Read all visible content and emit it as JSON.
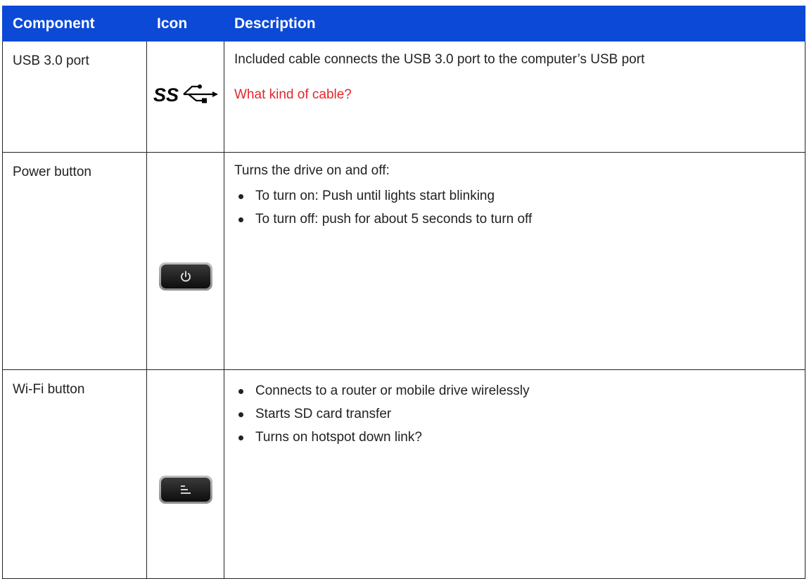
{
  "table": {
    "headers": {
      "component": "Component",
      "icon": "Icon",
      "description": "Description"
    },
    "rows": [
      {
        "component": "USB 3.0 port",
        "icon_name": "usb-superspeed-icon",
        "description": "Included cable connects the USB 3.0 port to the computer’s USB port",
        "note": "What kind of cable?"
      },
      {
        "component": "Power button",
        "icon_name": "power-button-icon",
        "description": "Turns the drive on and off:",
        "bullets": [
          "To turn on: Push until lights start blinking",
          "To turn off: push for about 5 seconds to turn off"
        ]
      },
      {
        "component": "Wi-Fi button",
        "icon_name": "wifi-button-icon",
        "bullets": [
          "Connects to a router or mobile drive wirelessly",
          "Starts SD card transfer",
          "Turns on hotspot down link?"
        ]
      }
    ]
  },
  "icons": {
    "usb_symbol_text": "SS"
  },
  "colors": {
    "header_background": "#0b49d6",
    "header_text": "#ffffff",
    "note_text": "#e3262b",
    "body_text": "#222222"
  }
}
